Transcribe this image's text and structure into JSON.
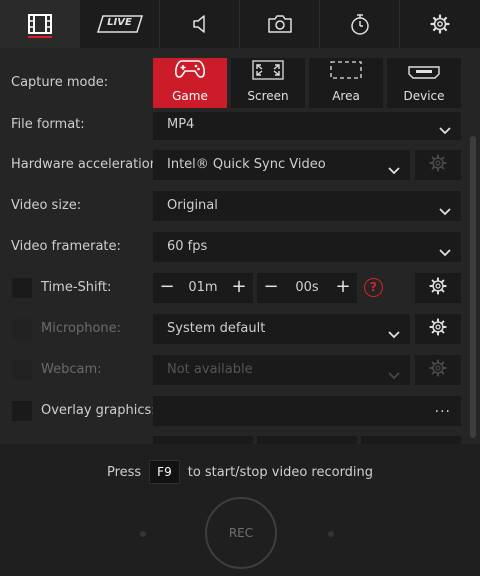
{
  "tabs": [
    {
      "name": "video-tab",
      "icon": "film-icon",
      "active": true
    },
    {
      "name": "live-tab",
      "icon": "live-icon",
      "label": "LIVE"
    },
    {
      "name": "audio-tab",
      "icon": "speaker-icon"
    },
    {
      "name": "screenshot-tab",
      "icon": "camera-icon"
    },
    {
      "name": "timer-tab",
      "icon": "stopwatch-icon"
    },
    {
      "name": "settings-tab",
      "icon": "gear-icon"
    }
  ],
  "capture": {
    "label": "Capture mode:",
    "modes": [
      {
        "label": "Game",
        "icon": "gamepad-icon",
        "selected": true
      },
      {
        "label": "Screen",
        "icon": "expand-icon"
      },
      {
        "label": "Area",
        "icon": "area-select-icon"
      },
      {
        "label": "Device",
        "icon": "hdmi-icon"
      }
    ]
  },
  "settings": {
    "file_format": {
      "label": "File format:",
      "value": "MP4"
    },
    "hw_accel": {
      "label": "Hardware acceleration:",
      "value": "Intel® Quick Sync Video"
    },
    "video_size": {
      "label": "Video size:",
      "value": "Original"
    },
    "framerate": {
      "label": "Video framerate:",
      "value": "60 fps"
    },
    "timeshift": {
      "label": "Time-Shift:",
      "minutes": "01m",
      "seconds": "00s",
      "help": "?"
    },
    "microphone": {
      "label": "Microphone:",
      "value": "System default"
    },
    "webcam": {
      "label": "Webcam:",
      "value": "Not available"
    },
    "overlay": {
      "label": "Overlay graphics:",
      "value": "",
      "more": "..."
    }
  },
  "footer": {
    "hint_before": "Press",
    "hotkey": "F9",
    "hint_after": "to start/stop video recording",
    "rec_label": "REC"
  },
  "colors": {
    "accent": "#cc1c2a",
    "background": "#252525",
    "control": "#1a1a1a"
  }
}
